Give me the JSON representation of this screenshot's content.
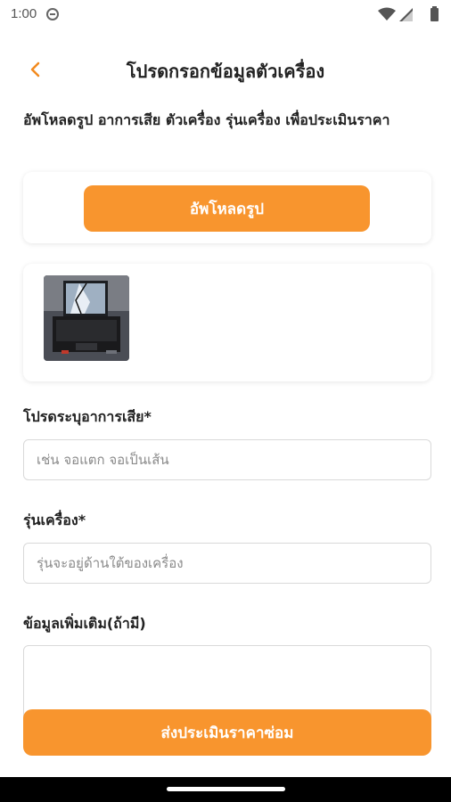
{
  "status_bar": {
    "time": "1:00",
    "icons": [
      "do-not-disturb-icon",
      "wifi-icon",
      "signal-icon",
      "battery-icon"
    ]
  },
  "header": {
    "back_icon": "chevron-left-icon",
    "title": "โปรดกรอกข้อมูลตัวเครื่อง"
  },
  "intro": {
    "text": "อัพโหลดรูป อาการเสีย ตัวเครื่อง รุ่นเครื่อง เพื่อประเมินราคา"
  },
  "upload": {
    "button_label": "อัพโหลดรูป"
  },
  "uploaded_images": [
    {
      "kind": "photo",
      "subject": "laptop"
    }
  ],
  "form": {
    "symptom": {
      "label": "โปรดระบุอาการเสีย*",
      "placeholder": "เช่น จอแตก จอเป็นเส้น",
      "value": ""
    },
    "model": {
      "label": "รุ่นเครื่อง*",
      "placeholder": "รุ่นจะอยู่ด้านใต้ของเครื่อง",
      "value": ""
    },
    "extra_info": {
      "label": "ข้อมูลเพิ่มเติม(ถ้ามี)",
      "value": ""
    }
  },
  "submit": {
    "label": "ส่งประเมินราคาซ่อม"
  },
  "colors": {
    "accent": "#f8952e",
    "back_icon": "#f28a1f"
  }
}
